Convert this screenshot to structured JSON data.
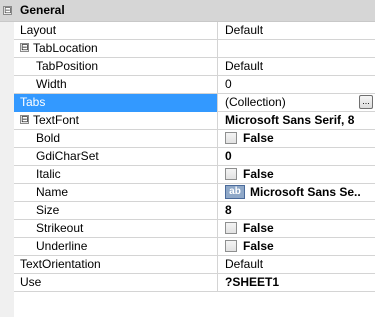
{
  "category": {
    "expander": "⊟",
    "label": "General"
  },
  "rows": [
    {
      "name": "Layout",
      "value": "Default"
    },
    {
      "name": "TabLocation",
      "value": "",
      "expander": "⊟"
    },
    {
      "name": "TabPosition",
      "value": "Default"
    },
    {
      "name": "Width",
      "value": "0"
    },
    {
      "name": "Tabs",
      "value": "(Collection)",
      "button": "..."
    },
    {
      "name": "TextFont",
      "value": "Microsoft Sans Serif, 8",
      "expander": "⊟"
    },
    {
      "name": "Bold",
      "value": "False",
      "checked": false
    },
    {
      "name": "GdiCharSet",
      "value": "0"
    },
    {
      "name": "Italic",
      "value": "False",
      "checked": false
    },
    {
      "name": "Name",
      "value": "Microsoft Sans Se..",
      "preview": "ab"
    },
    {
      "name": "Size",
      "value": "8"
    },
    {
      "name": "Strikeout",
      "value": "False",
      "checked": false
    },
    {
      "name": "Underline",
      "value": "False",
      "checked": false
    },
    {
      "name": "TextOrientation",
      "value": "Default"
    },
    {
      "name": "Use",
      "value": "?SHEET1"
    }
  ],
  "colors": {
    "selected_row": "#3399ff",
    "category_background": "#d6d6d6"
  }
}
